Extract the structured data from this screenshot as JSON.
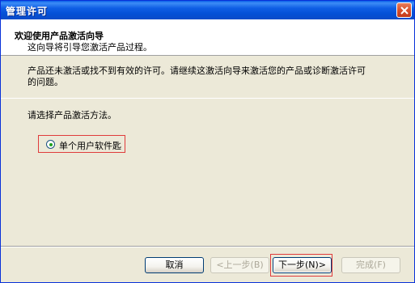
{
  "window": {
    "title": "管理许可"
  },
  "header": {
    "title": "欢迎使用产品激活向导",
    "subtitle": "这向导将引导您激活产品过程。"
  },
  "main": {
    "description": "产品还未激活或找不到有效的许可。请继续这激活向导来激活您的产品或诊断激活许可的问题。",
    "choose_label": "请选择产品激活方法。",
    "option_label": "单个用户软件匙",
    "option_selected": true
  },
  "buttons": {
    "cancel": "取消",
    "back": "<上一步(B)",
    "next": "下一步(N)>",
    "finish": "完成(F)"
  },
  "colors": {
    "titlebar": "#0a5fe8",
    "highlight_box": "#e03b3b",
    "dialog_bg": "#ece9d8"
  }
}
